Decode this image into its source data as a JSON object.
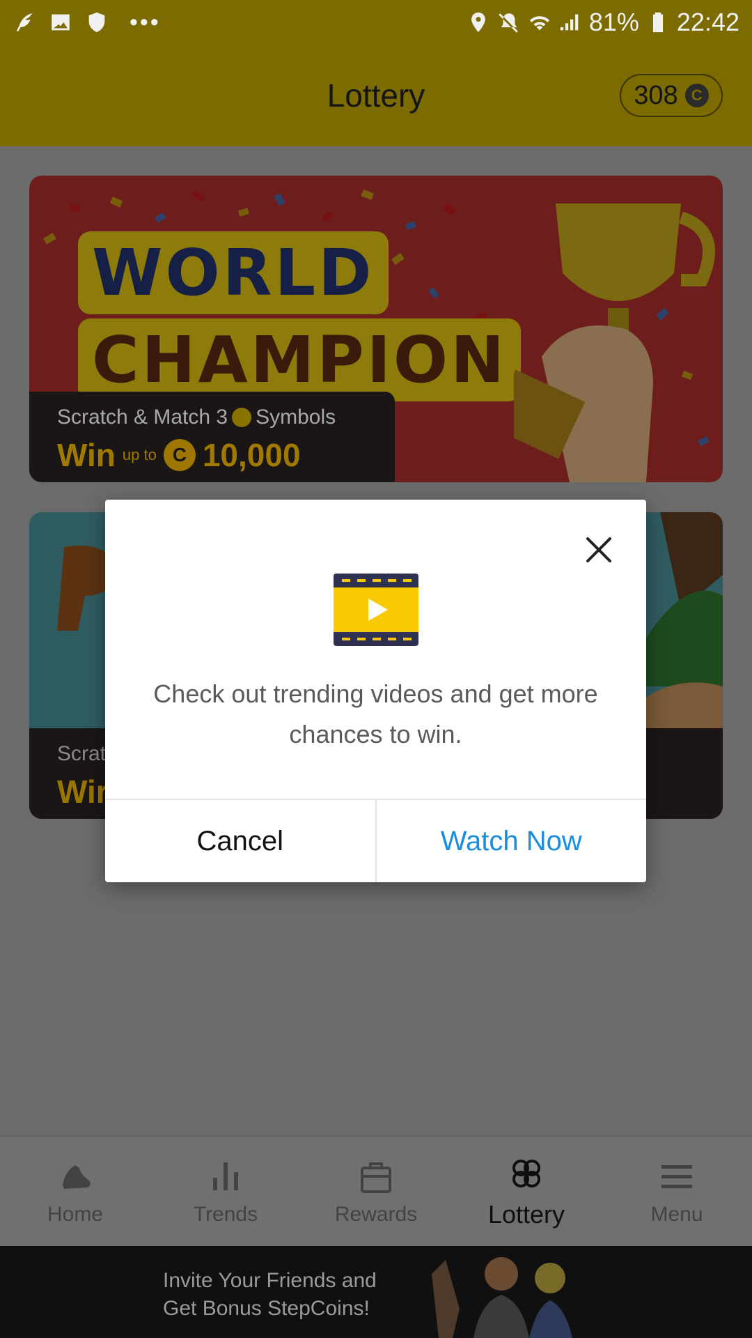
{
  "status_bar": {
    "battery": "81%",
    "time": "22:42",
    "left_icons": [
      "app-feather-icon",
      "image-icon",
      "shield-icon",
      "more-dots-icon"
    ],
    "right_icons": [
      "location-icon",
      "mute-icon",
      "wifi-icon",
      "signal-icon",
      "battery-icon"
    ]
  },
  "header": {
    "title": "Lottery",
    "coins": "308",
    "coin_symbol": "C"
  },
  "cards": [
    {
      "title_line1": "WORLD",
      "title_line2": "CHAMPION",
      "subtitle_pre": "Scratch & Match 3",
      "subtitle_post": "Symbols",
      "win": "Win",
      "up_to": "up to",
      "coin_symbol": "C",
      "amount": "10,000"
    },
    {
      "subtitle_partial": "Scrat",
      "win_partial": "Wir"
    }
  ],
  "dialog": {
    "message": "Check out trending videos and get more chances to win.",
    "cancel_label": "Cancel",
    "confirm_label": "Watch Now"
  },
  "nav": [
    {
      "label": "Home",
      "icon": "shoe-icon"
    },
    {
      "label": "Trends",
      "icon": "bar-chart-icon"
    },
    {
      "label": "Rewards",
      "icon": "bag-icon"
    },
    {
      "label": "Lottery",
      "icon": "clover-icon",
      "active": true
    },
    {
      "label": "Menu",
      "icon": "hamburger-icon"
    }
  ],
  "promo": {
    "line1": "Invite Your Friends and",
    "line2": "Get Bonus StepCoins!"
  },
  "colors": {
    "header": "#7c6b00",
    "accent_link": "#1a8ddd",
    "gold": "#a07a00"
  }
}
